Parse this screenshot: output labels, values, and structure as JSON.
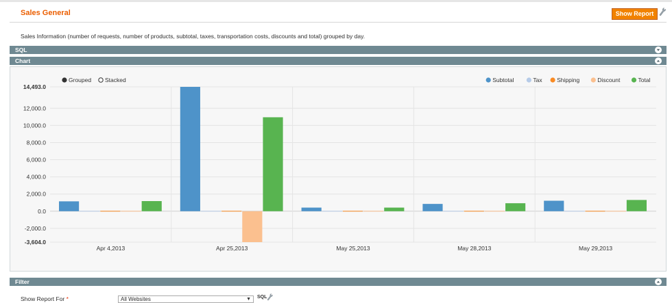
{
  "header": {
    "title": "Sales General",
    "show_report_label": "Show Report",
    "description": "Sales Information (number of requests, number of products, subtotal, taxes, transportation costs, discounts and total) grouped by day."
  },
  "sections": {
    "sql_label": "SQL",
    "chart_label": "Chart",
    "filter_label": "Filter"
  },
  "chart_mode": {
    "grouped_label": "Grouped",
    "stacked_label": "Stacked",
    "selected": "grouped"
  },
  "filter": {
    "show_report_for_label": "Show Report For",
    "required_mark": "*",
    "website_value": "All Websites",
    "sql_link": "SQL"
  },
  "colors": {
    "accent": "#eb5e00",
    "section_bar": "#6f8992",
    "button": "#f18200"
  },
  "chart_data": {
    "type": "bar",
    "categories": [
      "Apr 4,2013",
      "Apr 25,2013",
      "May 25,2013",
      "May 28,2013",
      "May 29,2013"
    ],
    "series": [
      {
        "name": "Subtotal",
        "color": "#4e93c9",
        "values": [
          1150,
          14493,
          420,
          850,
          1220
        ]
      },
      {
        "name": "Tax",
        "color": "#b6cbe8",
        "values": [
          0,
          0,
          0,
          0,
          0
        ]
      },
      {
        "name": "Shipping",
        "color": "#f98b24",
        "values": [
          0,
          0,
          0,
          0,
          0
        ]
      },
      {
        "name": "Discount",
        "color": "#fbc08f",
        "values": [
          0,
          -3604,
          0,
          0,
          0
        ]
      },
      {
        "name": "Total",
        "color": "#58b450",
        "values": [
          1180,
          10950,
          420,
          930,
          1310
        ]
      }
    ],
    "y_ticks": [
      "14,493.0",
      "12,000.0",
      "10,000.0",
      "8,000.0",
      "6,000.0",
      "4,000.0",
      "2,000.0",
      "0.0",
      "-2,000.0",
      "-3,604.0"
    ],
    "y_tick_values": [
      14493,
      12000,
      10000,
      8000,
      6000,
      4000,
      2000,
      0,
      -2000,
      -3604
    ],
    "ylim": [
      -3604,
      14493
    ],
    "grid": true,
    "legend_position": "top-right"
  }
}
